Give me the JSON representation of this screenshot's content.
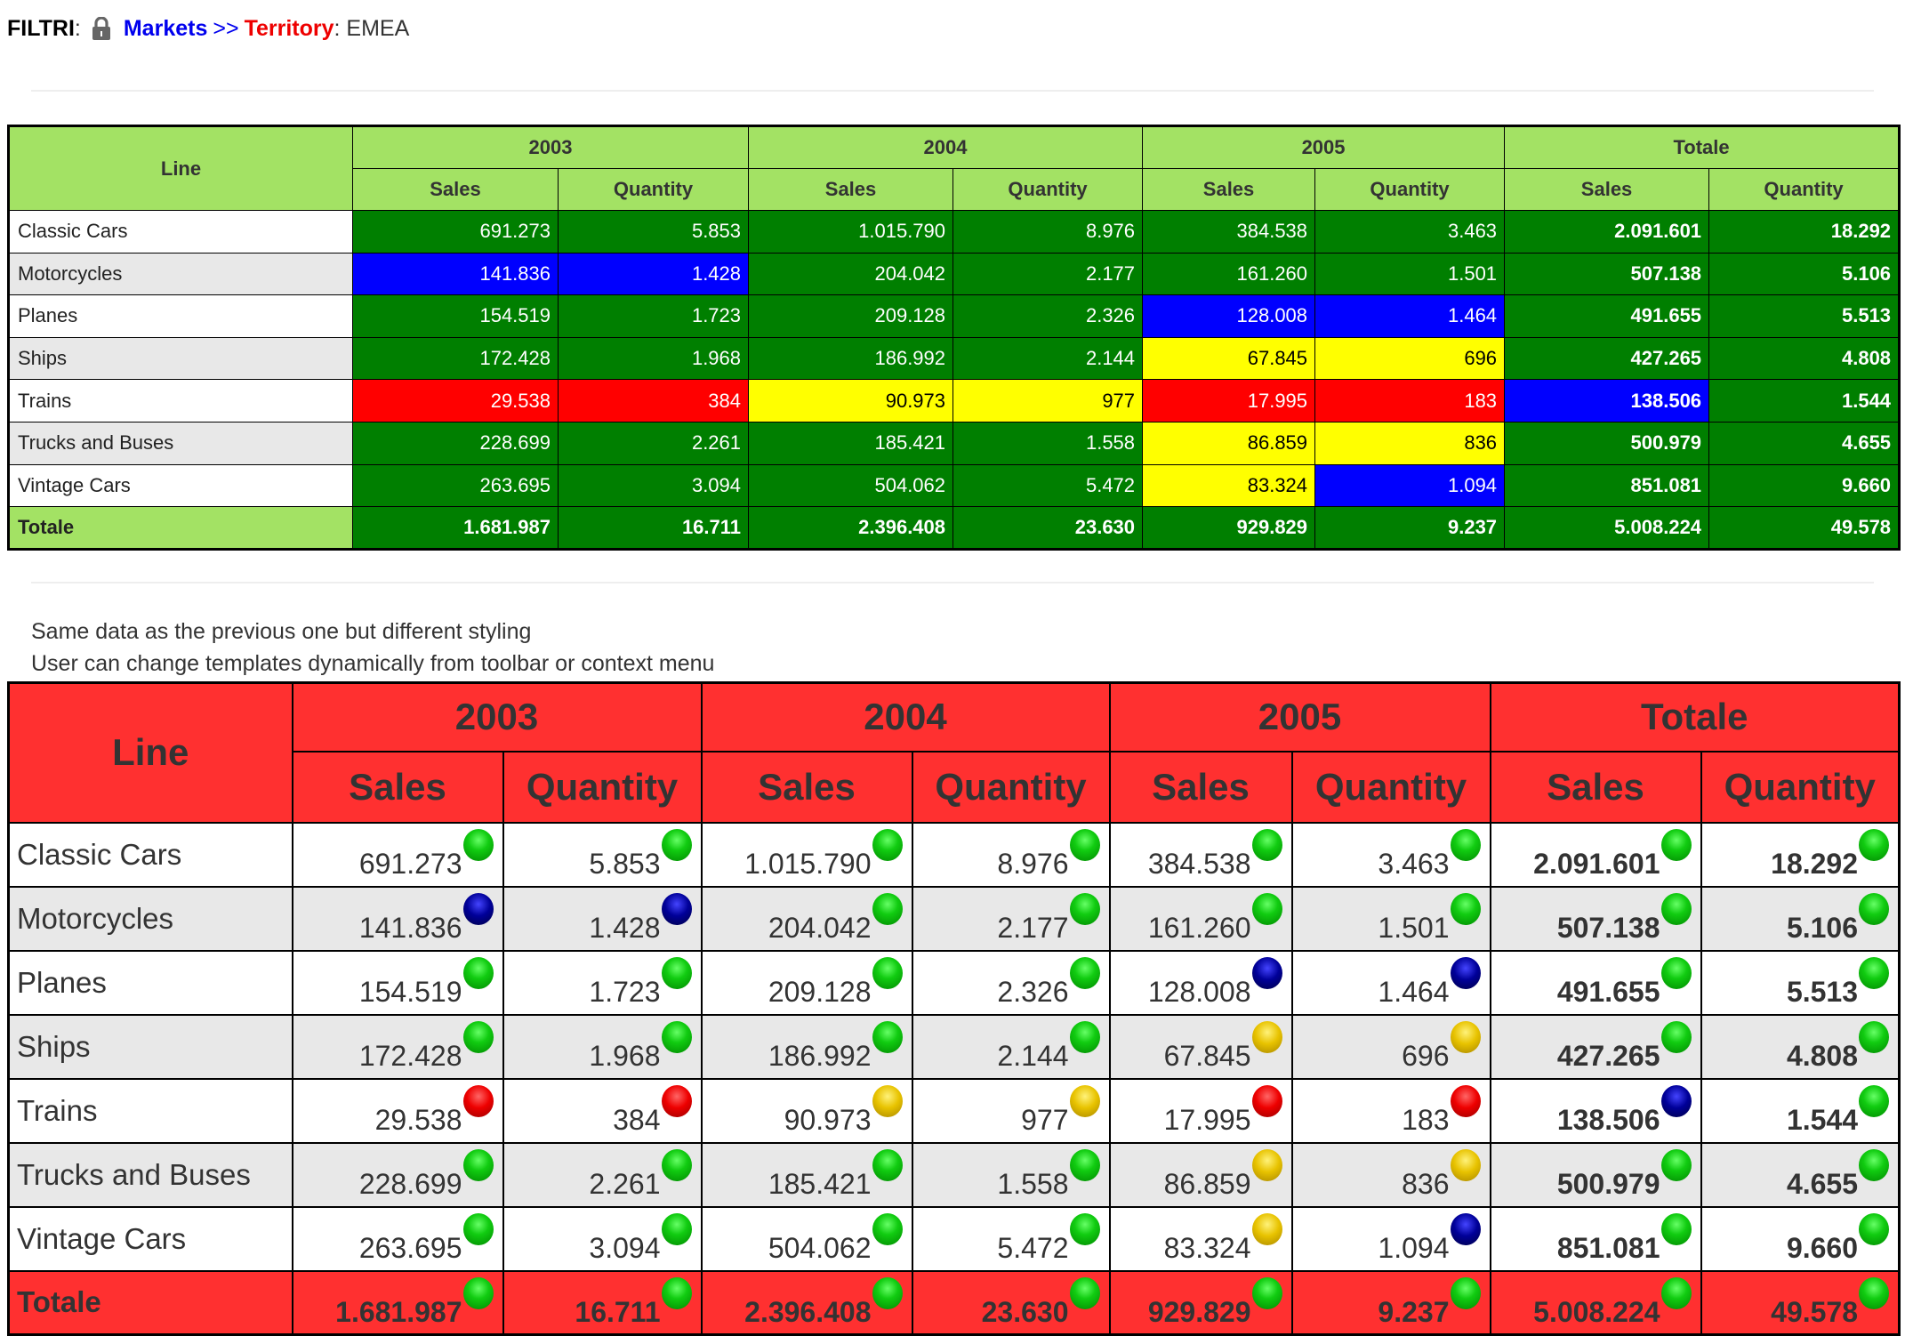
{
  "filter": {
    "label": "FILTRI",
    "colon": ":",
    "lock_icon": "lock-icon",
    "dimension": "Markets",
    "arrows": ">>",
    "level": "Territory",
    "level_colon": ":",
    "value": "EMEA"
  },
  "colors": {
    "header_green": "#a3e264",
    "cell_green": "#007f00",
    "cell_blue": "#0000ff",
    "cell_red": "#ff0000",
    "cell_yellow": "#ffff00",
    "header_red": "#ff3030",
    "link_blue": "#0000ee",
    "link_red": "#ee0000"
  },
  "table_headers": {
    "line": "Line",
    "groups": [
      "2003",
      "2004",
      "2005",
      "Totale"
    ],
    "measures": [
      "Sales",
      "Quantity",
      "Sales",
      "Quantity",
      "Sales",
      "Quantity",
      "Sales",
      "Quantity"
    ]
  },
  "notes": {
    "line1": "Same data as the previous one but different styling",
    "line2": "User can change templates dynamically from toolbar or context menu"
  },
  "rows": [
    {
      "line": "Classic Cars",
      "values": [
        "691.273",
        "5.853",
        "1.015.790",
        "8.976",
        "384.538",
        "3.463",
        "2.091.601",
        "18.292"
      ],
      "status": [
        "green",
        "green",
        "green",
        "green",
        "green",
        "green",
        "green",
        "green"
      ]
    },
    {
      "line": "Motorcycles",
      "values": [
        "141.836",
        "1.428",
        "204.042",
        "2.177",
        "161.260",
        "1.501",
        "507.138",
        "5.106"
      ],
      "status": [
        "blue",
        "blue",
        "green",
        "green",
        "green",
        "green",
        "green",
        "green"
      ]
    },
    {
      "line": "Planes",
      "values": [
        "154.519",
        "1.723",
        "209.128",
        "2.326",
        "128.008",
        "1.464",
        "491.655",
        "5.513"
      ],
      "status": [
        "green",
        "green",
        "green",
        "green",
        "blue",
        "blue",
        "green",
        "green"
      ]
    },
    {
      "line": "Ships",
      "values": [
        "172.428",
        "1.968",
        "186.992",
        "2.144",
        "67.845",
        "696",
        "427.265",
        "4.808"
      ],
      "status": [
        "green",
        "green",
        "green",
        "green",
        "yellow",
        "yellow",
        "green",
        "green"
      ]
    },
    {
      "line": "Trains",
      "values": [
        "29.538",
        "384",
        "90.973",
        "977",
        "17.995",
        "183",
        "138.506",
        "1.544"
      ],
      "status": [
        "red",
        "red",
        "yellow",
        "yellow",
        "red",
        "red",
        "blue",
        "green"
      ]
    },
    {
      "line": "Trucks and Buses",
      "values": [
        "228.699",
        "2.261",
        "185.421",
        "1.558",
        "86.859",
        "836",
        "500.979",
        "4.655"
      ],
      "status": [
        "green",
        "green",
        "green",
        "green",
        "yellow",
        "yellow",
        "green",
        "green"
      ]
    },
    {
      "line": "Vintage Cars",
      "values": [
        "263.695",
        "3.094",
        "504.062",
        "5.472",
        "83.324",
        "1.094",
        "851.081",
        "9.660"
      ],
      "status": [
        "green",
        "green",
        "green",
        "green",
        "yellow",
        "blue",
        "green",
        "green"
      ]
    }
  ],
  "total": {
    "line": "Totale",
    "values": [
      "1.681.987",
      "16.711",
      "2.396.408",
      "23.630",
      "929.829",
      "9.237",
      "5.008.224",
      "49.578"
    ],
    "status": [
      "green",
      "green",
      "green",
      "green",
      "green",
      "green",
      "green",
      "green"
    ]
  }
}
